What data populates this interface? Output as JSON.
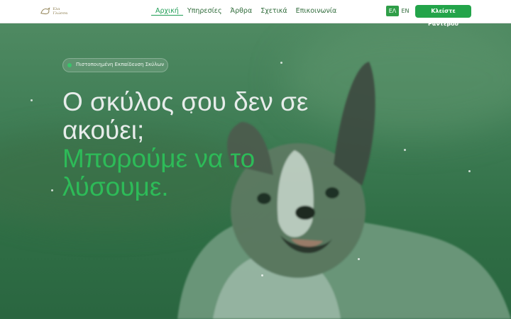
{
  "nav": {
    "logo_text": "Ελα Γλώσσα",
    "links": [
      "Αρχική",
      "Υπηρεσίες",
      "Άρθρα",
      "Σχετικά",
      "Επικοινωνία"
    ],
    "active_index": 0,
    "lang_el": "ΕΛ",
    "lang_en": "EN",
    "cta_label": "Κλείστε Ραντεβού"
  },
  "hero": {
    "badge": "Πιστοποιημένη Εκπαίδευση Σκύλων",
    "headline_line1": "Ο σκύλος σου δεν σε ακούει;",
    "headline_line2": "Μπορούμε να το λύσουμε."
  },
  "colors": {
    "brand_green": "#23a44a",
    "accent_green": "#2dbb58",
    "nav_text": "#2f6b3a"
  }
}
